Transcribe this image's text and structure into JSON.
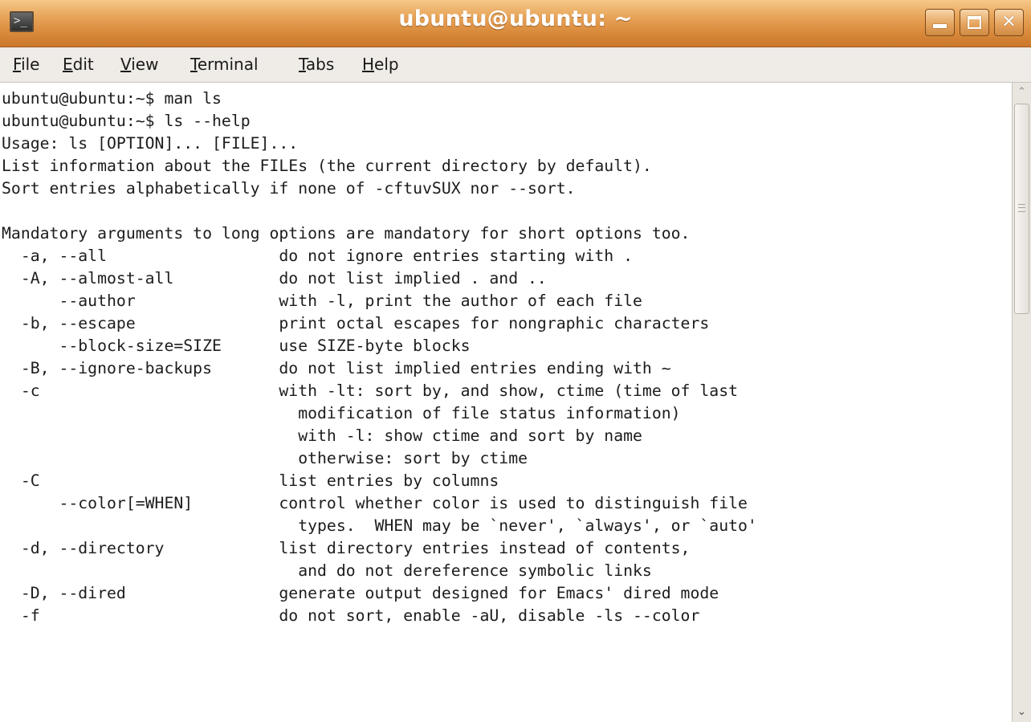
{
  "window": {
    "title": "ubuntu@ubuntu: ~",
    "icon": "terminal-icon",
    "buttons": {
      "minimize_icon": "minimize-icon",
      "maximize_icon": "maximize-icon",
      "close_icon": "close-icon",
      "close_glyph": "✕"
    }
  },
  "menu": {
    "file": {
      "u": "F",
      "rest": "ile"
    },
    "edit": {
      "u": "E",
      "rest": "dit"
    },
    "view": {
      "u": "V",
      "rest": "iew"
    },
    "terminal": {
      "u": "T",
      "rest": "erminal"
    },
    "tabs": {
      "u": "T",
      "rest": "abs"
    },
    "help": {
      "u": "H",
      "rest": "elp"
    }
  },
  "terminal": {
    "lines": [
      "ubuntu@ubuntu:~$ man ls",
      "ubuntu@ubuntu:~$ ls --help",
      "Usage: ls [OPTION]... [FILE]...",
      "List information about the FILEs (the current directory by default).",
      "Sort entries alphabetically if none of -cftuvSUX nor --sort.",
      "",
      "Mandatory arguments to long options are mandatory for short options too.",
      "  -a, --all                  do not ignore entries starting with .",
      "  -A, --almost-all           do not list implied . and ..",
      "      --author               with -l, print the author of each file",
      "  -b, --escape               print octal escapes for nongraphic characters",
      "      --block-size=SIZE      use SIZE-byte blocks",
      "  -B, --ignore-backups       do not list implied entries ending with ~",
      "  -c                         with -lt: sort by, and show, ctime (time of last",
      "                               modification of file status information)",
      "                               with -l: show ctime and sort by name",
      "                               otherwise: sort by ctime",
      "  -C                         list entries by columns",
      "      --color[=WHEN]         control whether color is used to distinguish file",
      "                               types.  WHEN may be `never', `always', or `auto'",
      "  -d, --directory            list directory entries instead of contents,",
      "                               and do not dereference symbolic links",
      "  -D, --dired                generate output designed for Emacs' dired mode",
      "  -f                         do not sort, enable -aU, disable -ls --color"
    ]
  },
  "scrollbar": {
    "up_glyph": "⌃",
    "down_glyph": "⌄",
    "position_fraction": 0.0
  },
  "colors": {
    "titlebar": "#d98a3b",
    "menubar": "#efebe7",
    "terminal_bg": "#ffffff",
    "terminal_fg": "#1c1c1c"
  }
}
